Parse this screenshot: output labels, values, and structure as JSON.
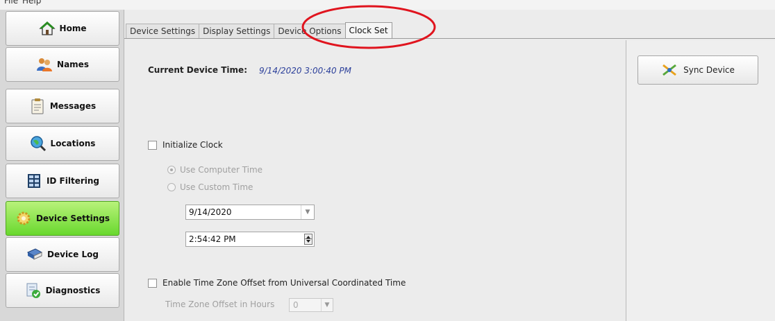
{
  "menubar": {
    "file_label": "File",
    "help_label": "Help"
  },
  "sidebar": {
    "items": [
      {
        "label": "Home",
        "icon": "home-icon"
      },
      {
        "label": "Names",
        "icon": "people-icon"
      },
      {
        "label": "Messages",
        "icon": "clipboard-icon"
      },
      {
        "label": "Locations",
        "icon": "globe-search-icon"
      },
      {
        "label": "ID Filtering",
        "icon": "id-grid-icon"
      },
      {
        "label": "Device Settings",
        "icon": "gear-icon",
        "active": true
      },
      {
        "label": "Device Log",
        "icon": "book-icon"
      },
      {
        "label": "Diagnostics",
        "icon": "diagnostics-icon"
      }
    ]
  },
  "tabs": [
    {
      "label": "Device Settings"
    },
    {
      "label": "Display Settings"
    },
    {
      "label": "Device Options"
    },
    {
      "label": "Clock Set",
      "active": true
    }
  ],
  "clock": {
    "current_time_label": "Current Device Time:",
    "current_time_value": "9/14/2020 3:00:40 PM",
    "initialize_label": "Initialize Clock",
    "initialize_checked": false,
    "use_computer_time": "Use Computer Time",
    "use_custom_time": "Use Custom Time",
    "date_value": "9/14/2020",
    "time_value": "2:54:42 PM",
    "tz_enable_label": "Enable Time Zone Offset from Universal Coordinated Time",
    "tz_enable_checked": false,
    "tz_offset_label": "Time Zone Offset in Hours",
    "tz_offset_value": "0"
  },
  "sync": {
    "label": "Sync Device",
    "icon": "sync-icon"
  },
  "annotation": {
    "color": "#e0141e"
  }
}
